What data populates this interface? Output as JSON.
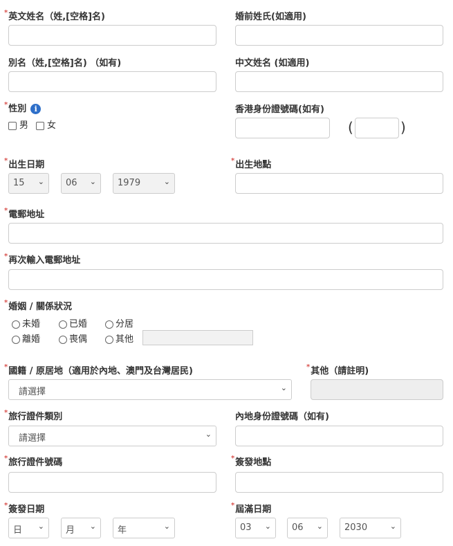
{
  "english_name": {
    "label": "英文姓名（姓,[空格]名)"
  },
  "maiden_name": {
    "label": "婚前姓氏(如適用)"
  },
  "alias": {
    "label": "別名（姓,[空格]名) （如有)"
  },
  "chinese_name": {
    "label": "中文姓名 (如適用)"
  },
  "gender": {
    "label": "性別",
    "info_icon": "i",
    "options": [
      "男",
      "女"
    ]
  },
  "hkid": {
    "label": "香港身份證號碼(如有)",
    "open_paren": "(",
    "close_paren": ")"
  },
  "dob": {
    "label": "出生日期",
    "day": "15",
    "month": "06",
    "year": "1979"
  },
  "birthplace": {
    "label": "出生地點"
  },
  "email": {
    "label": "電郵地址"
  },
  "email_confirm": {
    "label": "再次輸入電郵地址"
  },
  "marital": {
    "label": "婚姻 / 關係狀況",
    "options": [
      "未婚",
      "已婚",
      "分居",
      "離婚",
      "喪偶",
      "其他"
    ]
  },
  "nationality": {
    "label": "國籍 / 原居地（適用於內地、澳門及台灣居民)",
    "value": "請選擇"
  },
  "nationality_other": {
    "label": "其他（請註明)"
  },
  "travel_doc_type": {
    "label": "旅行證件類別",
    "value": "請選擇"
  },
  "mainland_id": {
    "label": "內地身份證號碼（如有)"
  },
  "travel_doc_no": {
    "label": "旅行證件號碼"
  },
  "issue_place": {
    "label": "簽發地點"
  },
  "issue_date": {
    "label": "簽發日期",
    "day": "日",
    "month": "月",
    "year": "年"
  },
  "expiry_date": {
    "label": "屆滿日期",
    "day": "03",
    "month": "06",
    "year": "2030"
  },
  "chevron": "⌄"
}
